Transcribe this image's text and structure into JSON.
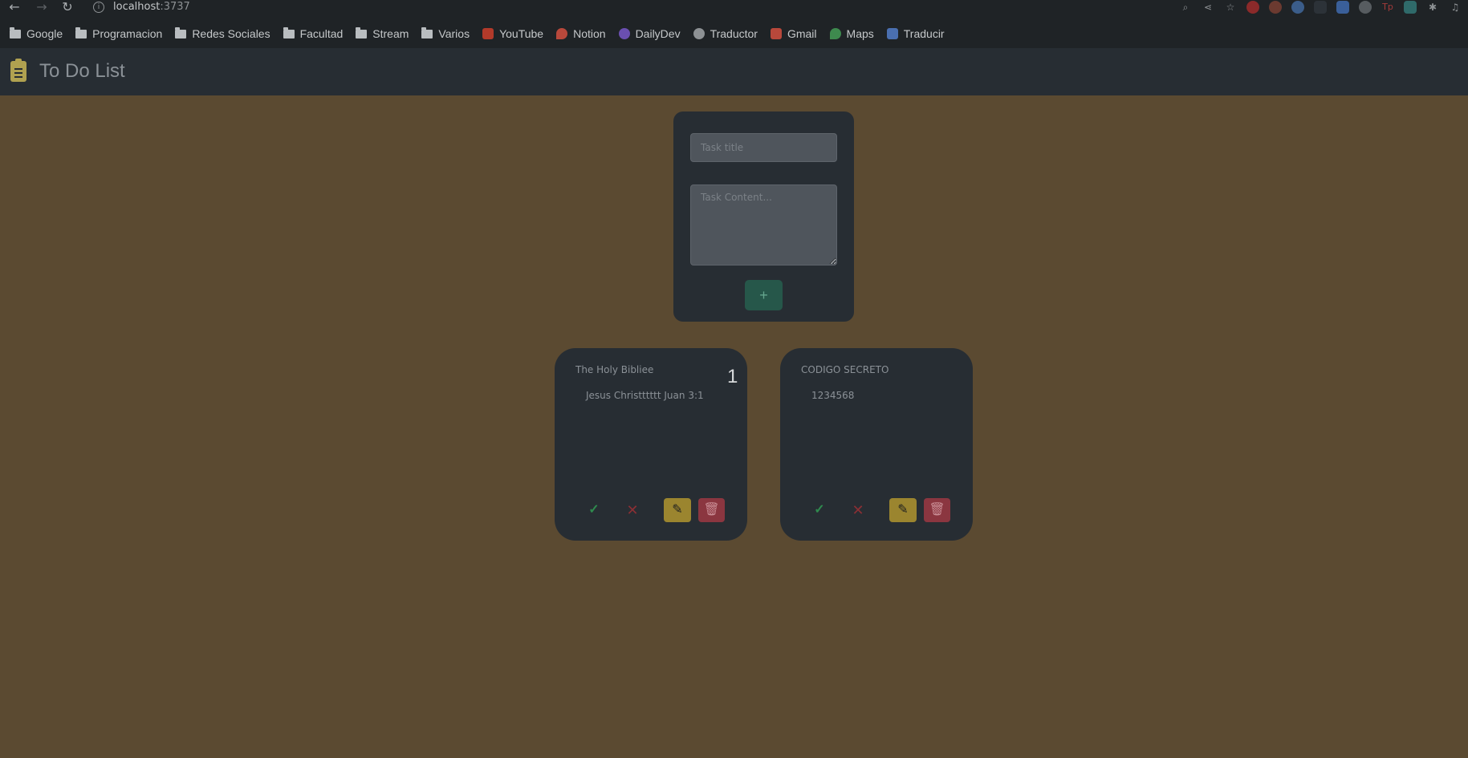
{
  "browser": {
    "url_host": "localhost",
    "url_port": ":3737",
    "bookmarks": [
      {
        "label": "Google",
        "icon": "folder-icon"
      },
      {
        "label": "Programacion",
        "icon": "folder-icon"
      },
      {
        "label": "Redes Sociales",
        "icon": "folder-icon"
      },
      {
        "label": "Facultad",
        "icon": "folder-icon"
      },
      {
        "label": "Stream",
        "icon": "folder-icon"
      },
      {
        "label": "Varios",
        "icon": "folder-icon"
      },
      {
        "label": "YouTube",
        "icon": "youtube-icon",
        "color": "#b23a2a"
      },
      {
        "label": "Notion",
        "icon": "pin-icon",
        "color": "#b8483b"
      },
      {
        "label": "DailyDev",
        "icon": "dailydev-icon",
        "color": "#6a4fb0"
      },
      {
        "label": "Traductor",
        "icon": "translate-icon",
        "color": "#8d9194"
      },
      {
        "label": "Gmail",
        "icon": "gmail-icon",
        "color": "#b8483b"
      },
      {
        "label": "Maps",
        "icon": "maps-icon",
        "color": "#3e8a4e"
      },
      {
        "label": "Traducir",
        "icon": "translate-icon",
        "color": "#4a6fb0"
      }
    ]
  },
  "app": {
    "title": "To Do List",
    "icon": "clipboard-icon"
  },
  "form": {
    "title_placeholder": "Task title",
    "content_placeholder": "Task Content...",
    "add_label": "+"
  },
  "tasks": [
    {
      "title": "The Holy Bibliee",
      "content": "Jesus Christttttt Juan 3:1",
      "number": "1"
    },
    {
      "title": "CODIGO SECRETO",
      "content": "1234568",
      "number": ""
    }
  ],
  "actions": {
    "done_label": "✓",
    "cancel_label": "✕",
    "edit_label": "✎",
    "delete_label": "🗑"
  },
  "colors": {
    "background": "#5b4a31",
    "card": "#272d33",
    "add_button": "#26574a",
    "edit_button": "#9b852f",
    "delete_button": "#8b3640"
  }
}
